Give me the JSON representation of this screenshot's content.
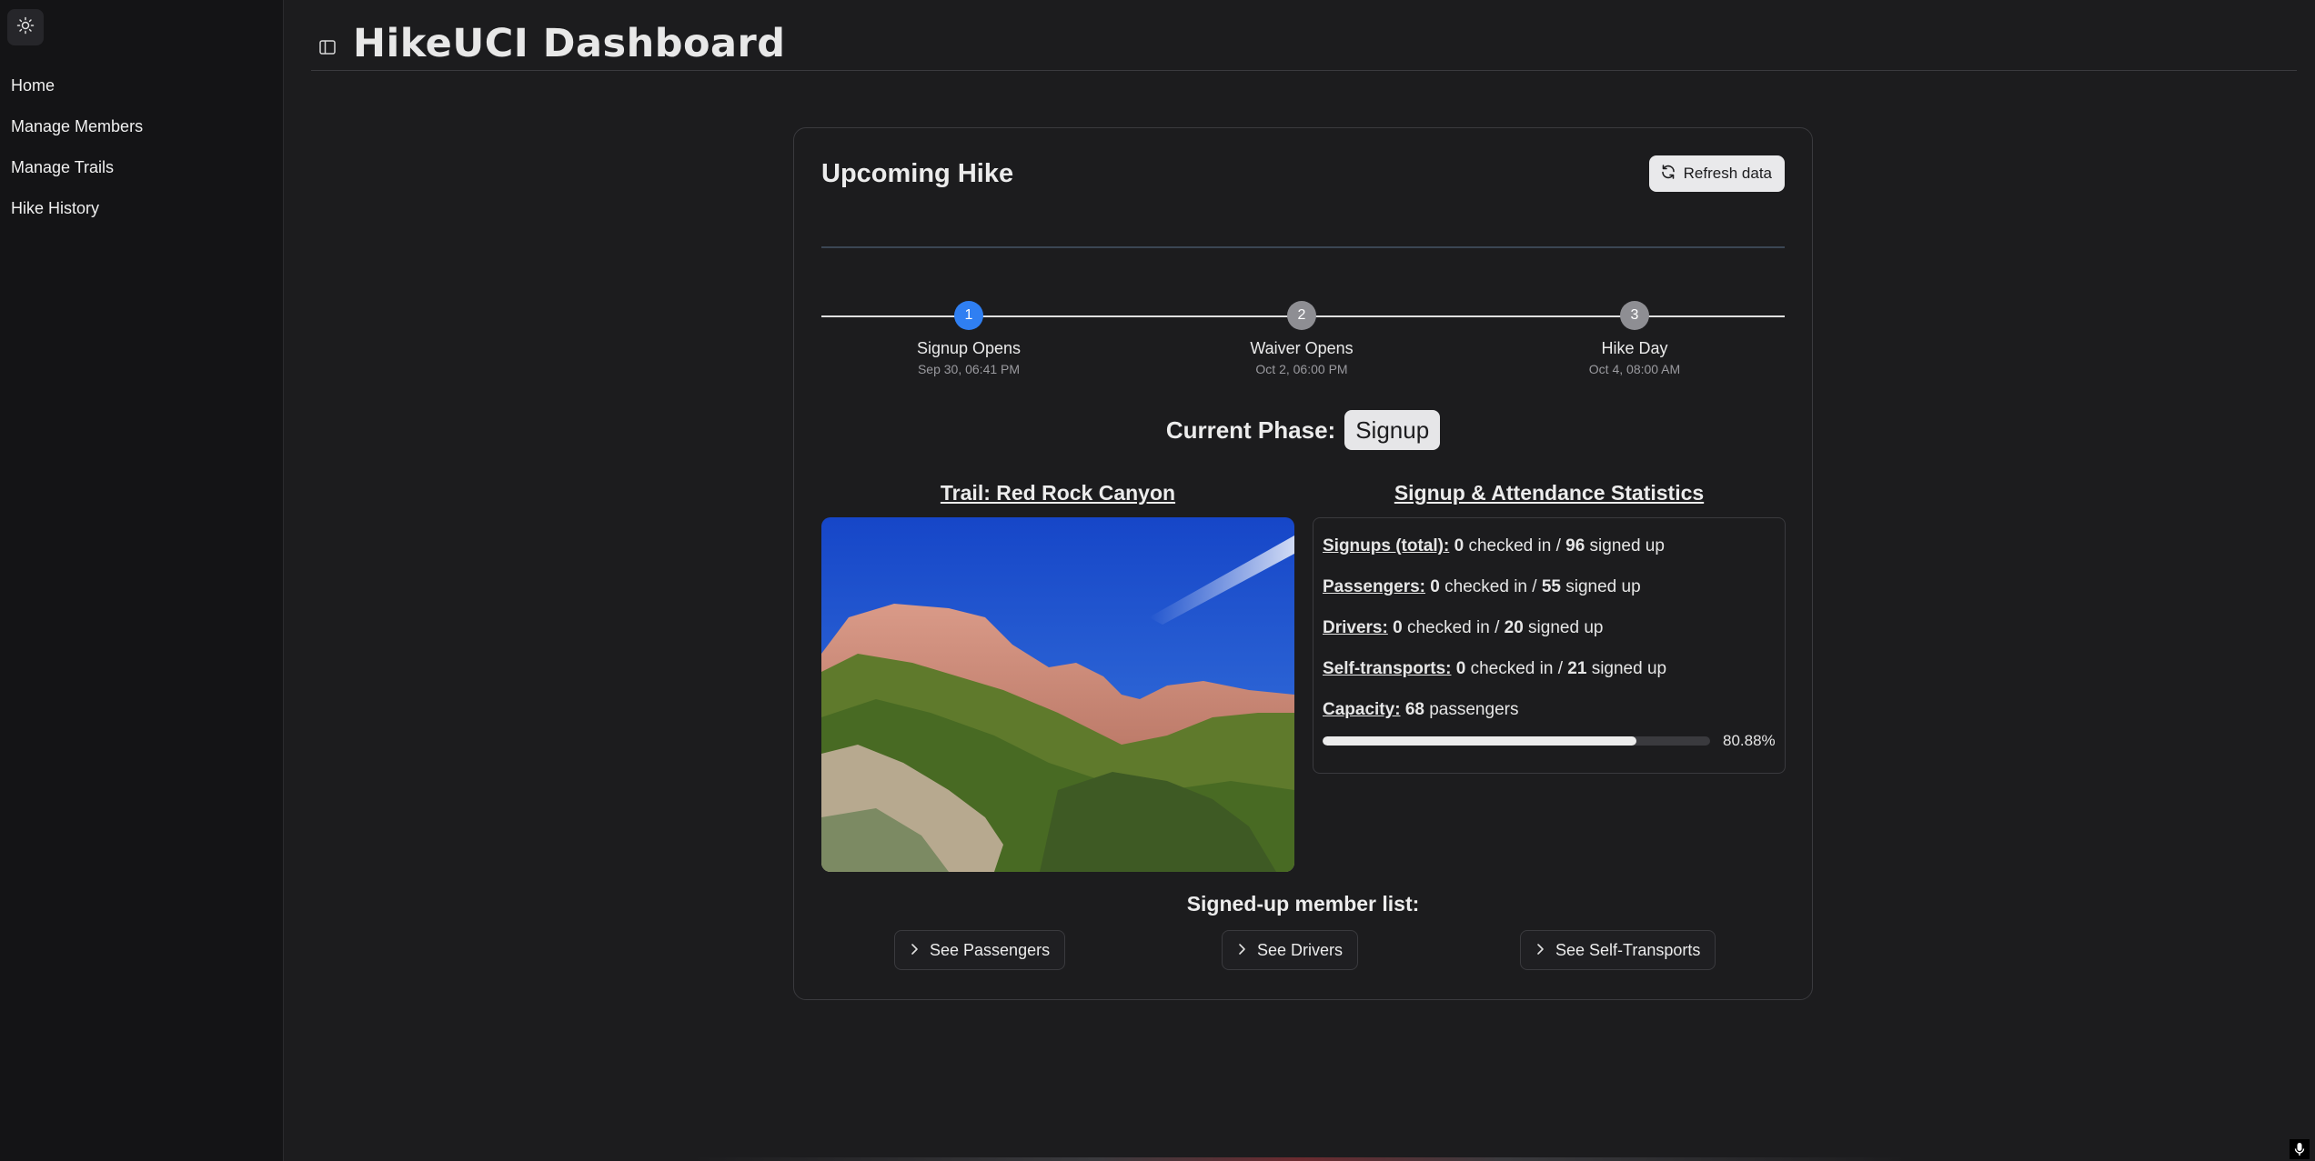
{
  "sidebar": {
    "theme_icon": "sun-icon",
    "items": [
      {
        "label": "Home"
      },
      {
        "label": "Manage Members"
      },
      {
        "label": "Manage Trails"
      },
      {
        "label": "Hike History"
      }
    ]
  },
  "header": {
    "toggle_icon": "sidebar-toggle-icon",
    "title": "HikeUCI Dashboard"
  },
  "card": {
    "title": "Upcoming Hike",
    "refresh_label": "Refresh data",
    "timeline": [
      {
        "number": "1",
        "label": "Signup Opens",
        "date": "Sep 30, 06:41 PM",
        "active": true
      },
      {
        "number": "2",
        "label": "Waiver Opens",
        "date": "Oct 2, 06:00 PM",
        "active": false
      },
      {
        "number": "3",
        "label": "Hike Day",
        "date": "Oct 4, 08:00 AM",
        "active": false
      }
    ],
    "phase_label": "Current Phase:",
    "phase_value": "Signup",
    "trail_heading": "Trail: Red Rock Canyon",
    "stats_heading": "Signup & Attendance Statistics",
    "stats": {
      "signups": {
        "label": "Signups (total):",
        "checked_in": "0",
        "mid": " checked in / ",
        "signed_up": "96",
        "tail": " signed up"
      },
      "passengers": {
        "label": "Passengers:",
        "checked_in": "0",
        "mid": " checked in / ",
        "signed_up": "55",
        "tail": " signed up"
      },
      "drivers": {
        "label": "Drivers:",
        "checked_in": "0",
        "mid": " checked in / ",
        "signed_up": "20",
        "tail": " signed up"
      },
      "self_transports": {
        "label": "Self-transports:",
        "checked_in": "0",
        "mid": " checked in / ",
        "signed_up": "21",
        "tail": " signed up"
      },
      "capacity": {
        "label": "Capacity:",
        "value": "68",
        "unit": " passengers"
      },
      "progress_text": "80.88%",
      "progress_value": 0.8088
    },
    "member_heading": "Signed-up member list:",
    "member_buttons": [
      {
        "label": "See Passengers"
      },
      {
        "label": "See Drivers"
      },
      {
        "label": "See Self-Transports"
      }
    ]
  },
  "colors": {
    "accent": "#2f7ff2",
    "background": "#1c1c1e",
    "sidebar": "#141416"
  }
}
